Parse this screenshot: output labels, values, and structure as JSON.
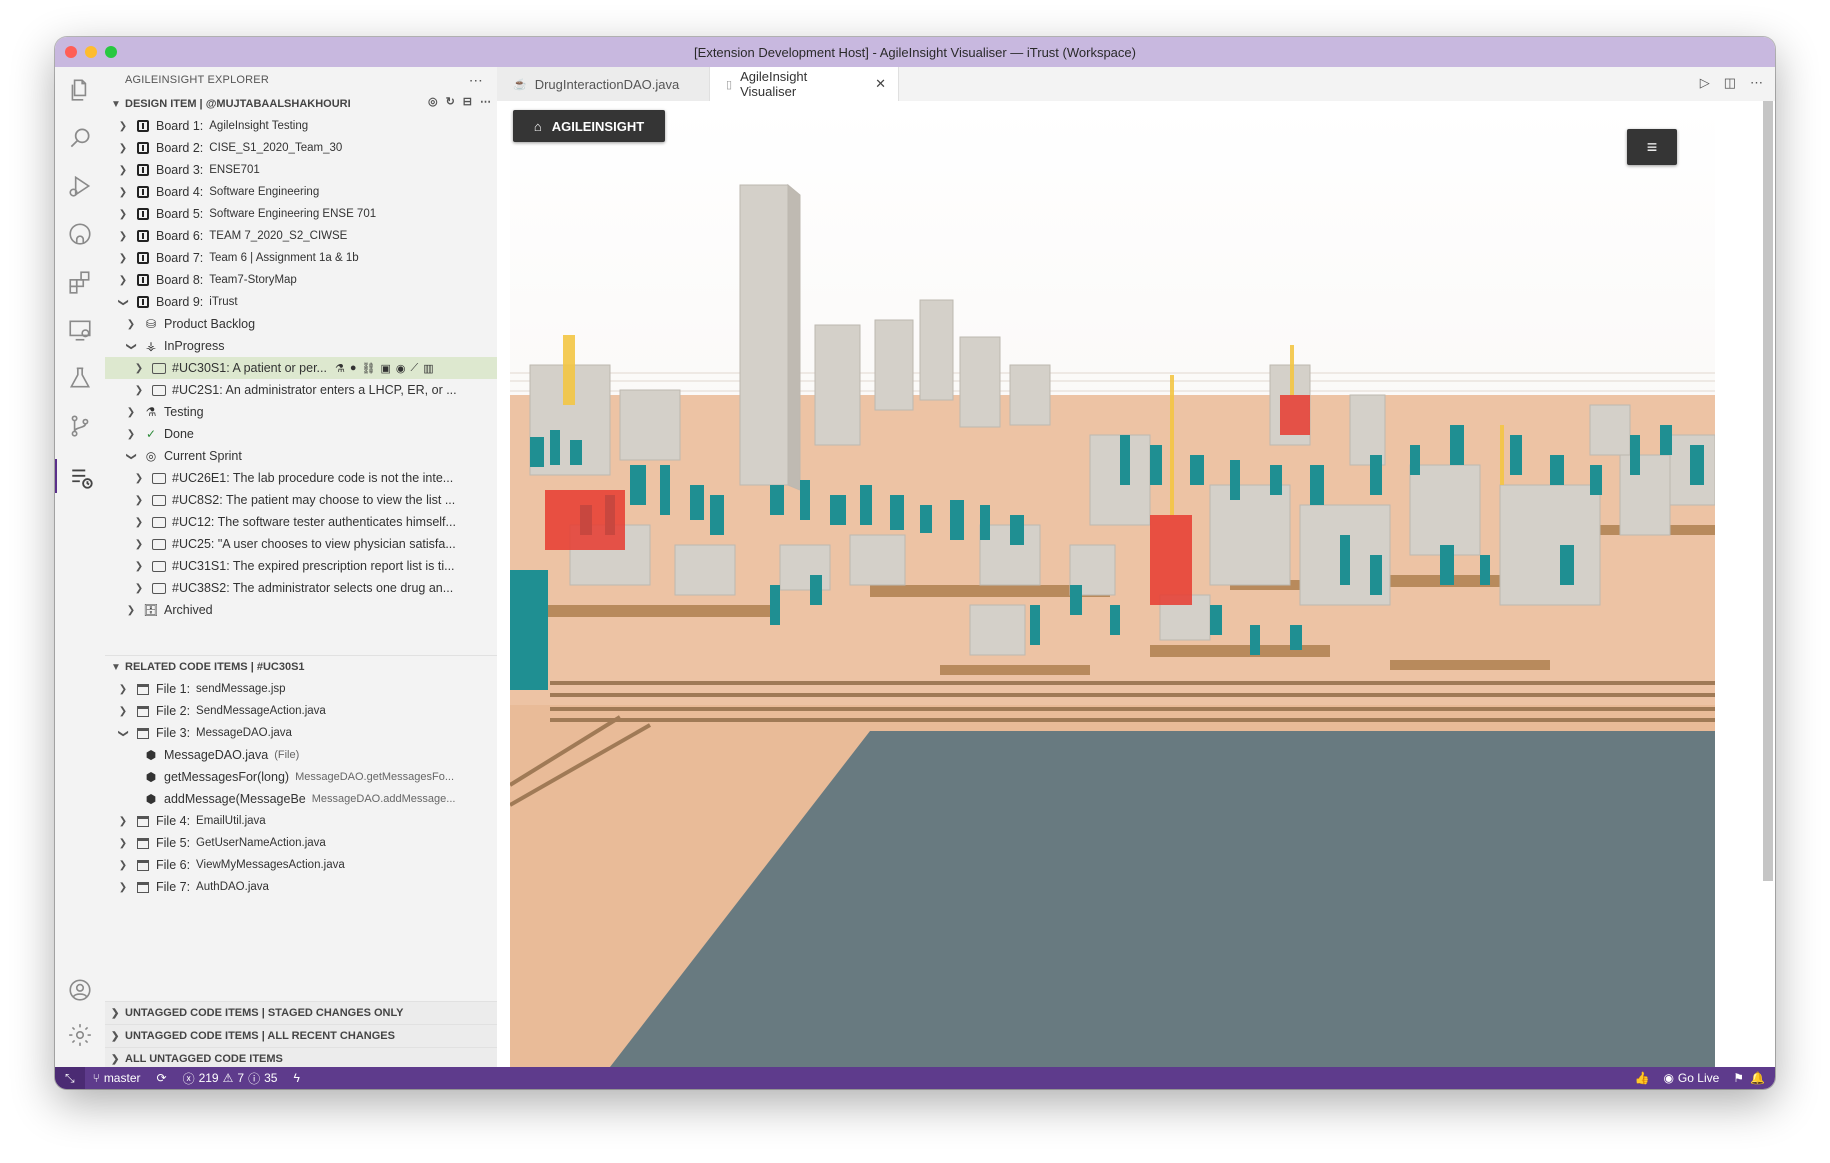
{
  "window": {
    "title": "[Extension Development Host] - AgileInsight Visualiser — iTrust (Workspace)",
    "colors": {
      "close": "#ff5f57",
      "minimize": "#febc2e",
      "maximize": "#28c840",
      "titlebar": "#c8b8df",
      "statusbar": "#5e3b8c"
    }
  },
  "activity_bar": {
    "top": [
      "files-icon",
      "search-icon",
      "run-debug-icon",
      "github-icon",
      "extensions-icon",
      "remote-explorer-icon",
      "testing-icon",
      "source-control-icon",
      "agileinsight-icon"
    ],
    "bottom": [
      "account-icon",
      "settings-gear-icon"
    ]
  },
  "sidebar": {
    "header": "AGILEINSIGHT EXPLORER",
    "design_section": {
      "title": "DESIGN ITEM | @MUJTABAALSHAKHOURI",
      "boards": [
        {
          "label": "Board 1:",
          "name": "AgileInsight Testing"
        },
        {
          "label": "Board 2:",
          "name": "CISE_S1_2020_Team_30"
        },
        {
          "label": "Board 3:",
          "name": "ENSE701"
        },
        {
          "label": "Board 4:",
          "name": "Software Engineering"
        },
        {
          "label": "Board 5:",
          "name": "Software Engineering ENSE 701"
        },
        {
          "label": "Board 6:",
          "name": "TEAM 7_2020_S2_CIWSE"
        },
        {
          "label": "Board 7:",
          "name": "Team 6 | Assignment 1a & 1b"
        },
        {
          "label": "Board 8:",
          "name": "Team7-StoryMap"
        },
        {
          "label": "Board 9:",
          "name": "iTrust"
        }
      ],
      "lists": {
        "product_backlog": "Product Backlog",
        "in_progress": "InProgress",
        "in_progress_items": [
          "#UC30S1: A patient or per...",
          "#UC2S1: An administrator enters a LHCP, ER, or ..."
        ],
        "testing": "Testing",
        "done": "Done",
        "current_sprint": "Current Sprint",
        "sprint_items": [
          "#UC26E1: The lab procedure code is not the inte...",
          "#UC8S2: The patient may choose to view the list ...",
          "#UC12: The software tester authenticates himself...",
          "#UC25: \"A user chooses to view physician satisfa...",
          "#UC31S1: The expired prescription report list is ti...",
          "#UC38S2: The administrator selects one drug an..."
        ],
        "archived": "Archived"
      }
    },
    "related_section": {
      "title": "RELATED CODE ITEMS | #UC30S1",
      "files": [
        {
          "label": "File 1:",
          "name": "sendMessage.jsp"
        },
        {
          "label": "File 2:",
          "name": "SendMessageAction.java"
        },
        {
          "label": "File 3:",
          "name": "MessageDAO.java"
        },
        {
          "label": "File 4:",
          "name": "EmailUtil.java"
        },
        {
          "label": "File 5:",
          "name": "GetUserNameAction.java"
        },
        {
          "label": "File 6:",
          "name": "ViewMyMessagesAction.java"
        },
        {
          "label": "File 7:",
          "name": "AuthDAO.java"
        }
      ],
      "children": [
        {
          "name": "MessageDAO.java",
          "desc": "(File)"
        },
        {
          "name": "getMessagesFor(long)",
          "desc": "MessageDAO.getMessagesFo..."
        },
        {
          "name": "addMessage(MessageBe",
          "desc": "MessageDAO.addMessage..."
        }
      ]
    },
    "collapsed_sections": [
      "UNTAGGED CODE ITEMS | STAGED CHANGES ONLY",
      "UNTAGGED CODE ITEMS | ALL RECENT CHANGES",
      "ALL UNTAGGED CODE ITEMS"
    ]
  },
  "tabs": [
    {
      "label": "DrugInteractionDAO.java"
    },
    {
      "label": "AgileInsight Visualiser"
    }
  ],
  "visualiser": {
    "home_button": "AGILEINSIGHT"
  },
  "statusbar": {
    "branch": "master",
    "errors": "219",
    "warnings": "7",
    "infos": "35",
    "go_live": "Go Live"
  }
}
